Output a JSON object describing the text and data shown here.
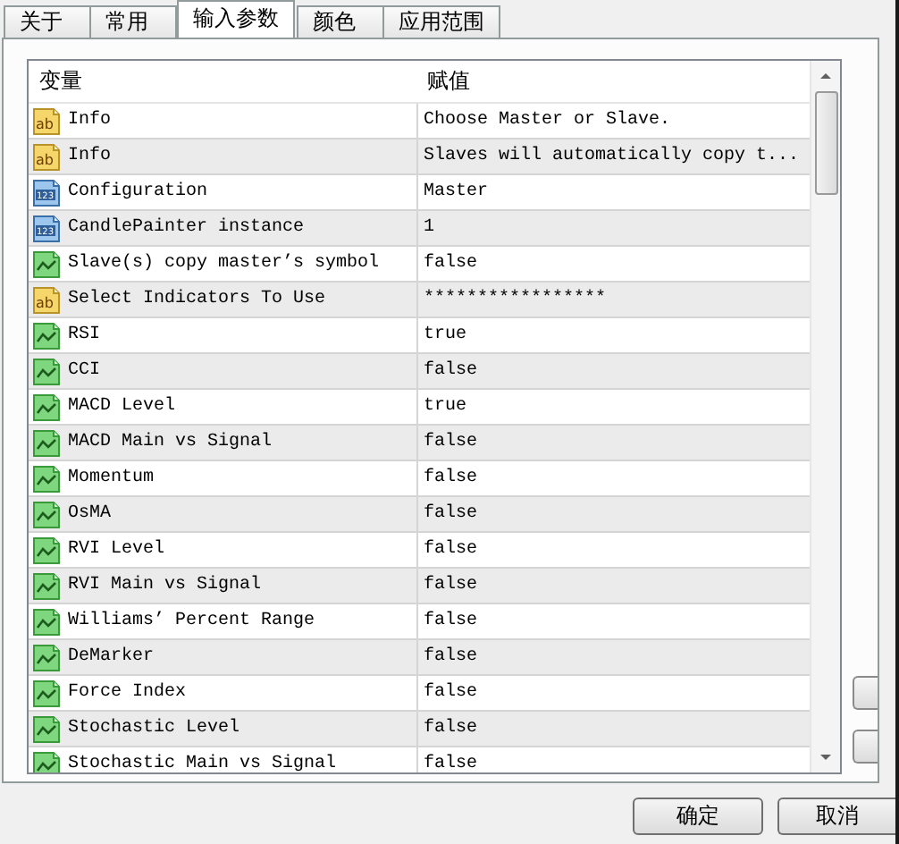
{
  "tabs": [
    {
      "label": "关于",
      "selected": false
    },
    {
      "label": "常用",
      "selected": false
    },
    {
      "label": "输入参数",
      "selected": true
    },
    {
      "label": "颜色",
      "selected": false
    },
    {
      "label": "应用范围",
      "selected": false
    }
  ],
  "table": {
    "columns": [
      "变量",
      "赋值"
    ],
    "rows": [
      {
        "kind": "text",
        "badge": "ab",
        "name": "Info",
        "value": "Choose Master or Slave."
      },
      {
        "kind": "text",
        "badge": "ab",
        "name": "Info",
        "value": "Slaves will automatically copy t..."
      },
      {
        "kind": "number",
        "badge": "123",
        "name": "Configuration",
        "value": "Master"
      },
      {
        "kind": "number",
        "badge": "123",
        "name": "CandlePainter instance",
        "value": "1"
      },
      {
        "kind": "bool",
        "name": "Slave(s) copy master’s symbol",
        "value": "false"
      },
      {
        "kind": "text",
        "badge": "ab",
        "name": "Select Indicators To Use",
        "value": "*****************"
      },
      {
        "kind": "bool",
        "name": "RSI",
        "value": "true"
      },
      {
        "kind": "bool",
        "name": "CCI",
        "value": "false"
      },
      {
        "kind": "bool",
        "name": "MACD Level",
        "value": "true"
      },
      {
        "kind": "bool",
        "name": "MACD Main vs Signal",
        "value": "false"
      },
      {
        "kind": "bool",
        "name": "Momentum",
        "value": "false"
      },
      {
        "kind": "bool",
        "name": "OsMA",
        "value": "false"
      },
      {
        "kind": "bool",
        "name": "RVI Level",
        "value": "false"
      },
      {
        "kind": "bool",
        "name": "RVI Main vs Signal",
        "value": "false"
      },
      {
        "kind": "bool",
        "name": "Williams’ Percent Range",
        "value": "false"
      },
      {
        "kind": "bool",
        "name": "DeMarker",
        "value": "false"
      },
      {
        "kind": "bool",
        "name": "Force Index",
        "value": "false"
      },
      {
        "kind": "bool",
        "name": "Stochastic Level",
        "value": "false"
      },
      {
        "kind": "bool",
        "name": "Stochastic Main vs Signal",
        "value": "false"
      }
    ]
  },
  "buttons": [
    "确定",
    "取消"
  ]
}
